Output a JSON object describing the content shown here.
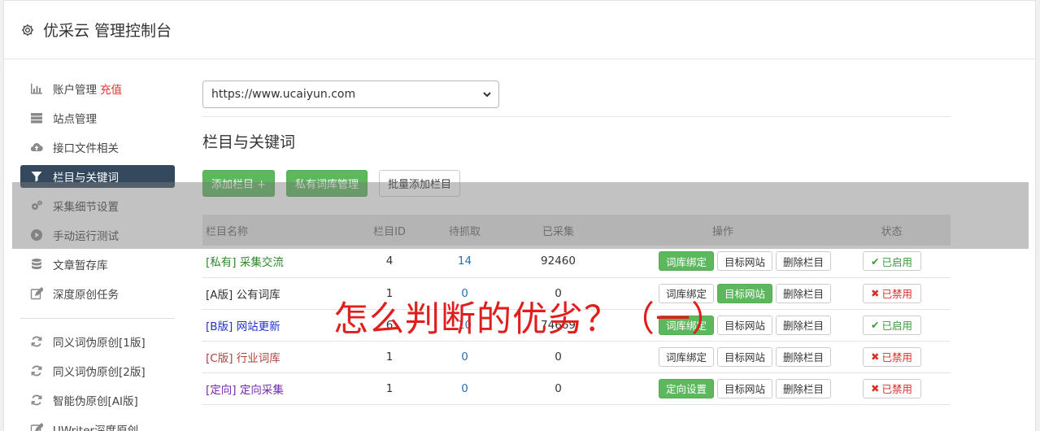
{
  "header": {
    "title": "优采云 管理控制台"
  },
  "sidebar": {
    "items": [
      {
        "label": "账户管理",
        "extra": "充值",
        "icon": "bar-chart-icon"
      },
      {
        "label": "站点管理",
        "icon": "server-icon"
      },
      {
        "label": "接口文件相关",
        "icon": "cloud-upload-icon"
      },
      {
        "label": "栏目与关键词",
        "icon": "filter-icon"
      },
      {
        "label": "采集细节设置",
        "icon": "cogs-icon"
      },
      {
        "label": "手动运行测试",
        "icon": "play-circle-icon"
      },
      {
        "label": "文章暂存库",
        "icon": "database-icon"
      },
      {
        "label": "深度原创任务",
        "icon": "edit-icon"
      }
    ],
    "items2": [
      {
        "label": "同义词伪原创[1版]",
        "icon": "refresh-icon"
      },
      {
        "label": "同义词伪原创[2版]",
        "icon": "refresh-icon"
      },
      {
        "label": "智能伪原创[AI版]",
        "icon": "refresh-icon"
      },
      {
        "label": "UWriter深度原创",
        "icon": "edit-icon"
      }
    ]
  },
  "main": {
    "site_select": "https://www.ucaiyun.com",
    "section_title": "栏目与关键词",
    "buttons": {
      "add_column": "添加栏目 +",
      "private_lib": "私有词库管理",
      "batch_add": "批量添加栏目"
    },
    "table": {
      "headers": {
        "name": "栏目名称",
        "id": "栏目ID",
        "pending": "待抓取",
        "collected": "已采集",
        "ops": "操作",
        "status": "状态"
      },
      "rows": [
        {
          "tag": "[私有]",
          "name": "采集交流",
          "id": "4",
          "pending": "14",
          "collected": "92460",
          "op1": "词库绑定",
          "op2": "目标网站",
          "op3": "删除栏目",
          "status": "已启用"
        },
        {
          "tag": "[A版]",
          "name": "公有词库",
          "id": "1",
          "pending": "0",
          "collected": "0",
          "op1": "词库绑定",
          "op2": "目标网站",
          "op3": "删除栏目",
          "status": "已禁用"
        },
        {
          "tag": "[B版]",
          "name": "网站更新",
          "id": "6",
          "pending": "10",
          "collected": "74669",
          "op1": "词库绑定",
          "op2": "目标网站",
          "op3": "删除栏目",
          "status": "已启用"
        },
        {
          "tag": "[C版]",
          "name": "行业词库",
          "id": "1",
          "pending": "0",
          "collected": "0",
          "op1": "词库绑定",
          "op2": "目标网站",
          "op3": "删除栏目",
          "status": "已禁用"
        },
        {
          "tag": "[定向]",
          "name": "定向采集",
          "id": "1",
          "pending": "0",
          "collected": "0",
          "op1": "定向设置",
          "op2": "目标网站",
          "op3": "删除栏目",
          "status": "已禁用"
        }
      ]
    }
  },
  "overlay": {
    "caption": "怎么判断的优劣？（一）"
  },
  "colors": {
    "active_nav": "#34495e",
    "green": "#5cb85c",
    "red": "#d9302c",
    "caption": "#e01e1e"
  }
}
